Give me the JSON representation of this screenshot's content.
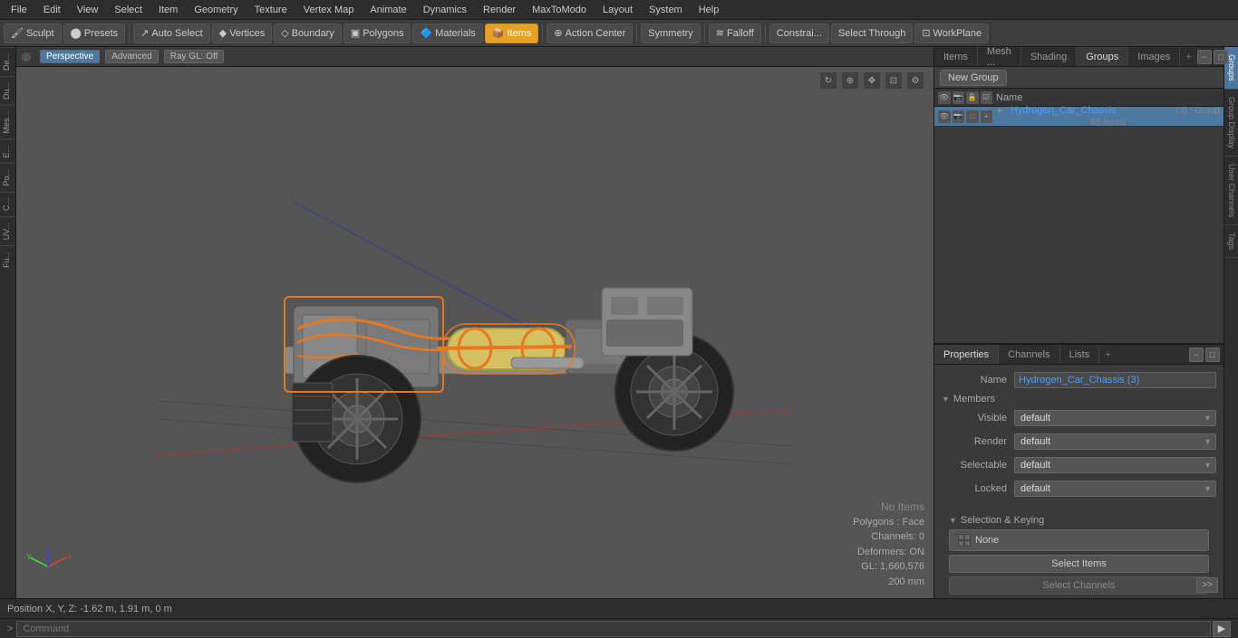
{
  "menu": {
    "items": [
      "File",
      "Edit",
      "View",
      "Select",
      "Item",
      "Geometry",
      "Texture",
      "Vertex Map",
      "Animate",
      "Dynamics",
      "Render",
      "MaxToModo",
      "Layout",
      "System",
      "Help"
    ]
  },
  "toolbar": {
    "sculpt_label": "Sculpt",
    "presets_label": "Presets",
    "auto_select_label": "Auto Select",
    "boundary_label": "Boundary",
    "polygons_label": "Polygons",
    "materials_label": "Materials",
    "items_label": "Items",
    "action_center_label": "Action Center",
    "symmetry_label": "Symmetry",
    "falloff_label": "Falloff",
    "constraints_label": "Constrai...",
    "select_through_label": "Select Through",
    "workplane_label": "WorkPlane"
  },
  "viewport": {
    "perspective_label": "Perspective",
    "advanced_label": "Advanced",
    "ray_gl_label": "Ray GL: Off"
  },
  "left_tabs": {
    "items": [
      "De...",
      "Du...",
      "Mes...",
      "E...",
      "Po...",
      "C...",
      "UV...",
      "Fu..."
    ]
  },
  "right_panel": {
    "tabs": [
      "Items",
      "Mesh ...",
      "Shading",
      "Groups",
      "Images"
    ],
    "active_tab": "Groups",
    "groups": {
      "new_group_label": "New Group",
      "column_name": "Name",
      "item": {
        "name": "Hydrogen_Car_Chassis",
        "suffix": "(3) : Group",
        "count": "65 Items"
      }
    }
  },
  "properties": {
    "tabs": [
      "Properties",
      "Channels",
      "Lists"
    ],
    "name_label": "Name",
    "name_value": "Hydrogen_Car_Chassis (3)",
    "members_label": "Members",
    "visible_label": "Visible",
    "visible_value": "default",
    "render_label": "Render",
    "render_value": "default",
    "selectable_label": "Selectable",
    "selectable_value": "default",
    "locked_label": "Locked",
    "locked_value": "default",
    "selection_keying_label": "Selection & Keying",
    "none_label": "None",
    "select_items_label": "Select Items",
    "select_channels_label": "Select Channels"
  },
  "scene_status": {
    "no_items": "No Items",
    "polygons": "Polygons : Face",
    "channels": "Channels: 0",
    "deformers": "Deformers: ON",
    "gl": "GL: 1,660,576",
    "size": "200 mm"
  },
  "status_bar": {
    "position": "Position X, Y, Z:   -1.62 m, 1.91 m, 0 m"
  },
  "command_bar": {
    "prompt": ">",
    "placeholder": "Command"
  },
  "right_vertical_tabs": [
    "Groups",
    "Group Display",
    "User Channels",
    "Tags"
  ]
}
